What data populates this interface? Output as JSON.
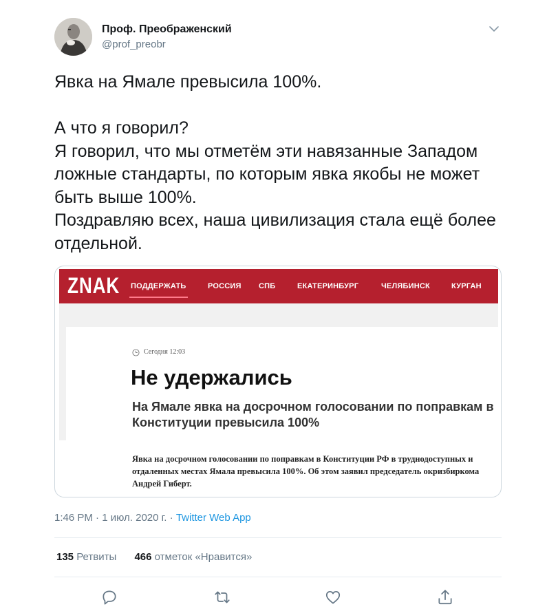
{
  "author": {
    "name": "Проф. Преображенский",
    "handle": "@prof_preobr"
  },
  "tweet": {
    "text": "Явка на Ямале превысила 100%.\n\nА что я говорил?\nЯ говорил, что мы отметём эти навязанные Западом ложные стандарты, по которым явка якобы не может быть выше 100%.\nПоздравляю всех, наша цивилизация стала ещё более отдельной."
  },
  "card": {
    "logo": "ZNAK",
    "nav": [
      "ПОДДЕРЖАТЬ",
      "РОССИЯ",
      "СПБ",
      "ЕКАТЕРИНБУРГ",
      "ЧЕЛЯБИНСК",
      "КУРГАН"
    ],
    "date": "Сегодня 12:03",
    "title": "Не удержались",
    "lead": "На Ямале явка на досрочном голосовании по поправкам в Конституции превысила 100%",
    "body": "Явка на досрочном голосовании по поправкам в Конституции РФ в труднодоступных и отдаленных местах Ямала превысила 100%. Об этом заявил председатель окризбиркома Андрей Гиберт.",
    "brand_color": "#b5202e"
  },
  "meta": {
    "time": "1:46 PM",
    "separator": "·",
    "date": "1 июл. 2020 г.",
    "app": "Twitter Web App"
  },
  "stats": {
    "retweets_count": "135",
    "retweets_label": "Ретвиты",
    "likes_count": "466",
    "likes_label": "отметок «Нравится»"
  },
  "actions": [
    "reply-icon",
    "retweet-icon",
    "like-icon",
    "share-icon"
  ],
  "colors": {
    "link": "#1b95e0",
    "secondary_text": "#657786",
    "primary_text": "#14171a"
  }
}
